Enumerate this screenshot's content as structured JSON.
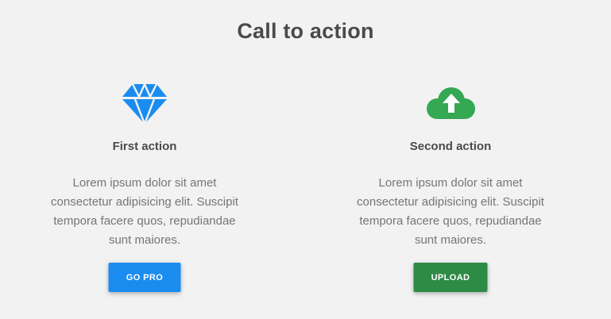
{
  "page": {
    "title": "Call to action"
  },
  "cards": [
    {
      "title": "First action",
      "text": "Lorem ipsum dolor sit amet consectetur adipisicing elit. Suscipit tempora facere quos, repudiandae sunt maiores.",
      "button_label": "GO PRO",
      "icon": "diamond-icon",
      "accent": "#1a8cf0"
    },
    {
      "title": "Second action",
      "text": "Lorem ipsum dolor sit amet consectetur adipisicing elit. Suscipit tempora facere quos, repudiandae sunt maiores.",
      "button_label": "UPLOAD",
      "icon": "cloud-upload-icon",
      "accent": "#34a853"
    }
  ]
}
